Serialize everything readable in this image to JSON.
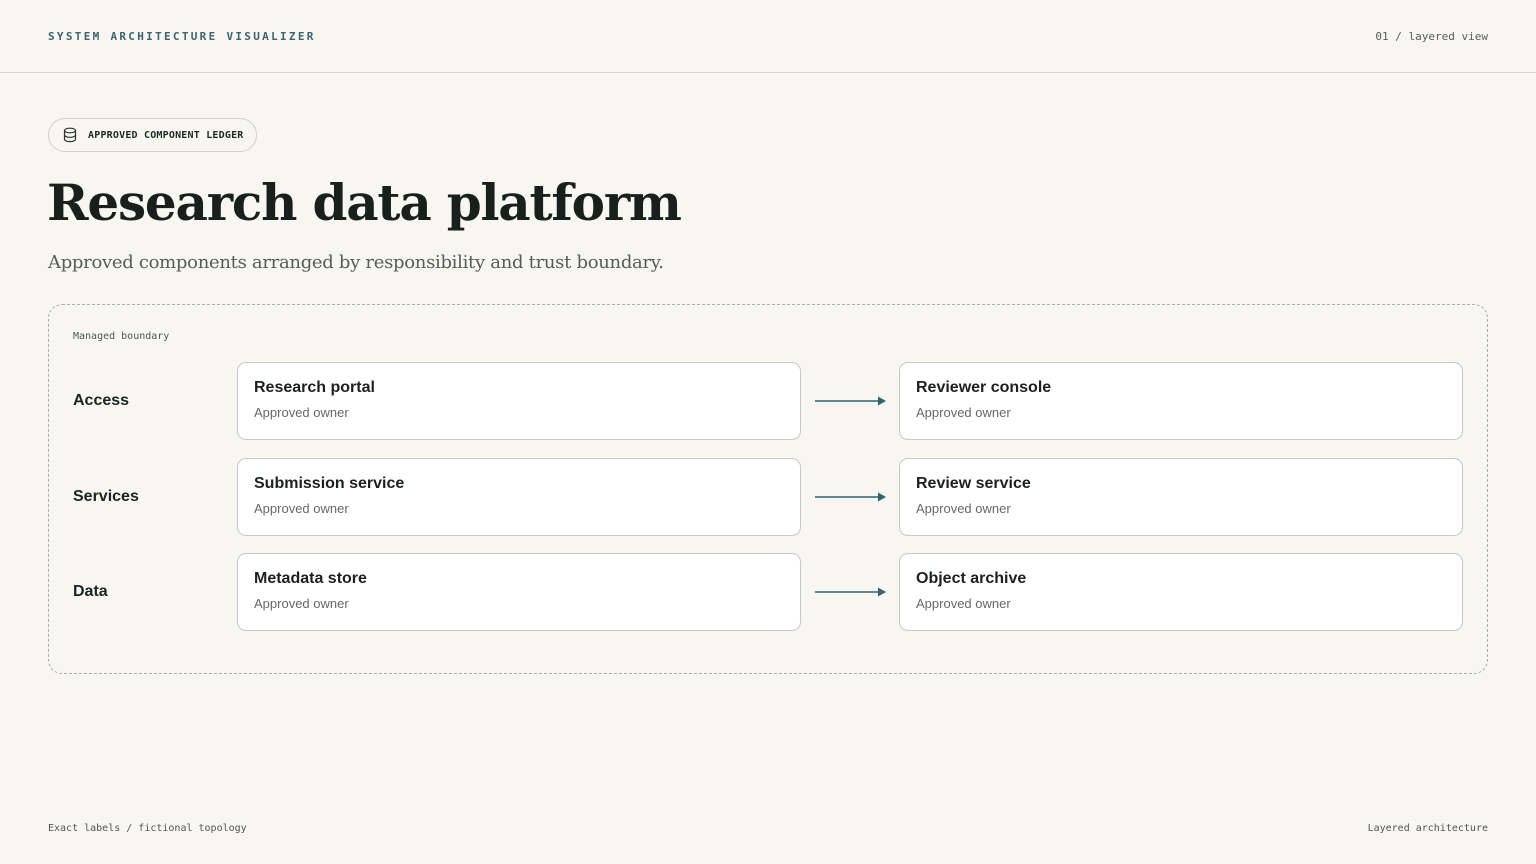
{
  "header": {
    "app_title": "SYSTEM ARCHITECTURE VISUALIZER",
    "view_label": "01 / layered view"
  },
  "badge": {
    "icon": "database-icon",
    "label": "APPROVED COMPONENT LEDGER"
  },
  "page": {
    "title": "Research data platform",
    "subtitle": "Approved components arranged by responsibility and trust boundary."
  },
  "diagram": {
    "boundary_label": "Managed boundary",
    "arrow_color": "#2f6473",
    "layers": [
      {
        "name": "Access",
        "source": {
          "title": "Research portal",
          "owner": "Approved owner"
        },
        "target": {
          "title": "Reviewer console",
          "owner": "Approved owner"
        }
      },
      {
        "name": "Services",
        "source": {
          "title": "Submission service",
          "owner": "Approved owner"
        },
        "target": {
          "title": "Review service",
          "owner": "Approved owner"
        }
      },
      {
        "name": "Data",
        "source": {
          "title": "Metadata store",
          "owner": "Approved owner"
        },
        "target": {
          "title": "Object archive",
          "owner": "Approved owner"
        }
      }
    ]
  },
  "footer": {
    "left": "Exact labels / fictional topology",
    "right": "Layered architecture"
  }
}
